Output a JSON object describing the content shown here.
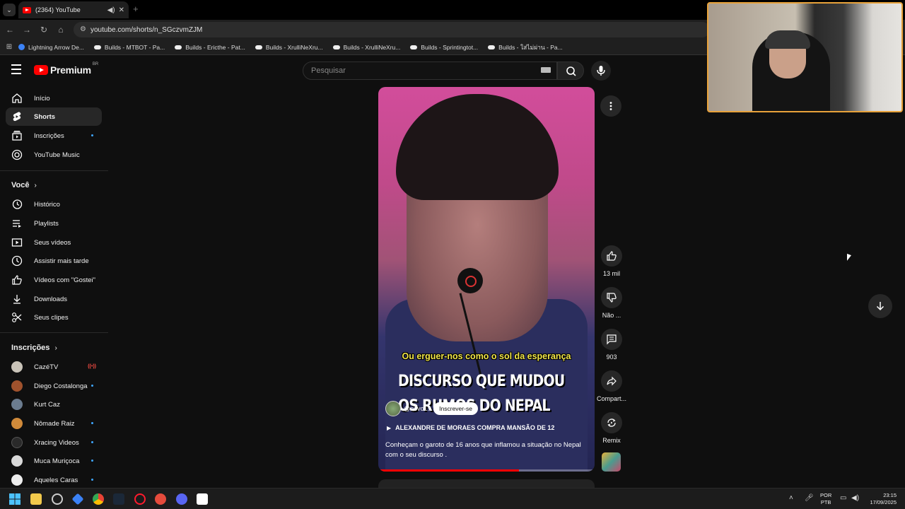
{
  "browser": {
    "tab_title": "(2364) YouTube",
    "url": "youtube.com/shorts/n_SGczvmZJM",
    "bookmarks": [
      "Lightning Arrow De...",
      "Builds - MTBOT - Pa...",
      "Builds - Ericthe - Pat...",
      "Builds - XrulliNeXru...",
      "Builds - XrulliNeXru...",
      "Builds - Sprintingtot...",
      "Builds - ใส่ไม่ผ่าน - Pa..."
    ]
  },
  "header": {
    "logo_text": "Premium",
    "logo_region": "BR",
    "search_placeholder": "Pesquisar"
  },
  "sidebar": {
    "main": [
      {
        "label": "Início",
        "icon": "home-icon"
      },
      {
        "label": "Shorts",
        "icon": "shorts-icon",
        "active": true
      },
      {
        "label": "Inscrições",
        "icon": "subscriptions-icon",
        "dot": true
      },
      {
        "label": "YouTube Music",
        "icon": "music-icon"
      }
    ],
    "you_title": "Você",
    "you": [
      {
        "label": "Histórico",
        "icon": "history-icon"
      },
      {
        "label": "Playlists",
        "icon": "playlists-icon"
      },
      {
        "label": "Seus vídeos",
        "icon": "your-videos-icon"
      },
      {
        "label": "Assistir mais tarde",
        "icon": "watch-later-icon"
      },
      {
        "label": "Vídeos com \"Gostei\"",
        "icon": "liked-icon"
      },
      {
        "label": "Downloads",
        "icon": "download-icon"
      },
      {
        "label": "Seus clipes",
        "icon": "clips-icon"
      }
    ],
    "subs_title": "Inscrições",
    "subscriptions": [
      {
        "label": "CazéTV",
        "color": "#c9c3b8",
        "live": true
      },
      {
        "label": "Diego Costalonga",
        "color": "#a0522d",
        "dot": true
      },
      {
        "label": "Kurt Caz",
        "color": "#6b7c8f",
        "dot": false
      },
      {
        "label": "Nômade Raiz",
        "color": "#d08a3a",
        "dot": true
      },
      {
        "label": "Xracing Videos",
        "color": "#2a2a2a",
        "dot": true
      },
      {
        "label": "Muca Muriçoca",
        "color": "#d9d9d9",
        "dot": true
      },
      {
        "label": "Aqueles Caras",
        "color": "#eeeeee",
        "dot": true
      }
    ]
  },
  "short": {
    "subtitle": "Ou erguer-nos como o sol da esperança",
    "headline_line1": "DISCURSO QUE MUDOU",
    "headline_line2": "OS RUMOS DO NEPAL",
    "channel": "@novo...",
    "subscribe_label": "Inscrever-se",
    "related": "ALEXANDRE DE MORAES COMPRA MANSÃO DE 12",
    "description": "Conheçam o garoto de 16 anos que inflamou a situação no Nepal com o seu discurso .",
    "progress": 0.65
  },
  "actions": {
    "likes": "13 mil",
    "dislike": "Não ...",
    "comments": "903",
    "share": "Compart...",
    "remix": "Remix"
  },
  "taskbar": {
    "lang1": "POR",
    "lang2": "PTB",
    "time": "23:15",
    "date": "17/09/2025"
  },
  "colors": {
    "accent_red": "#ff0000",
    "notification_dot": "#3ea6ff",
    "webcam_border": "#e8a23a"
  }
}
